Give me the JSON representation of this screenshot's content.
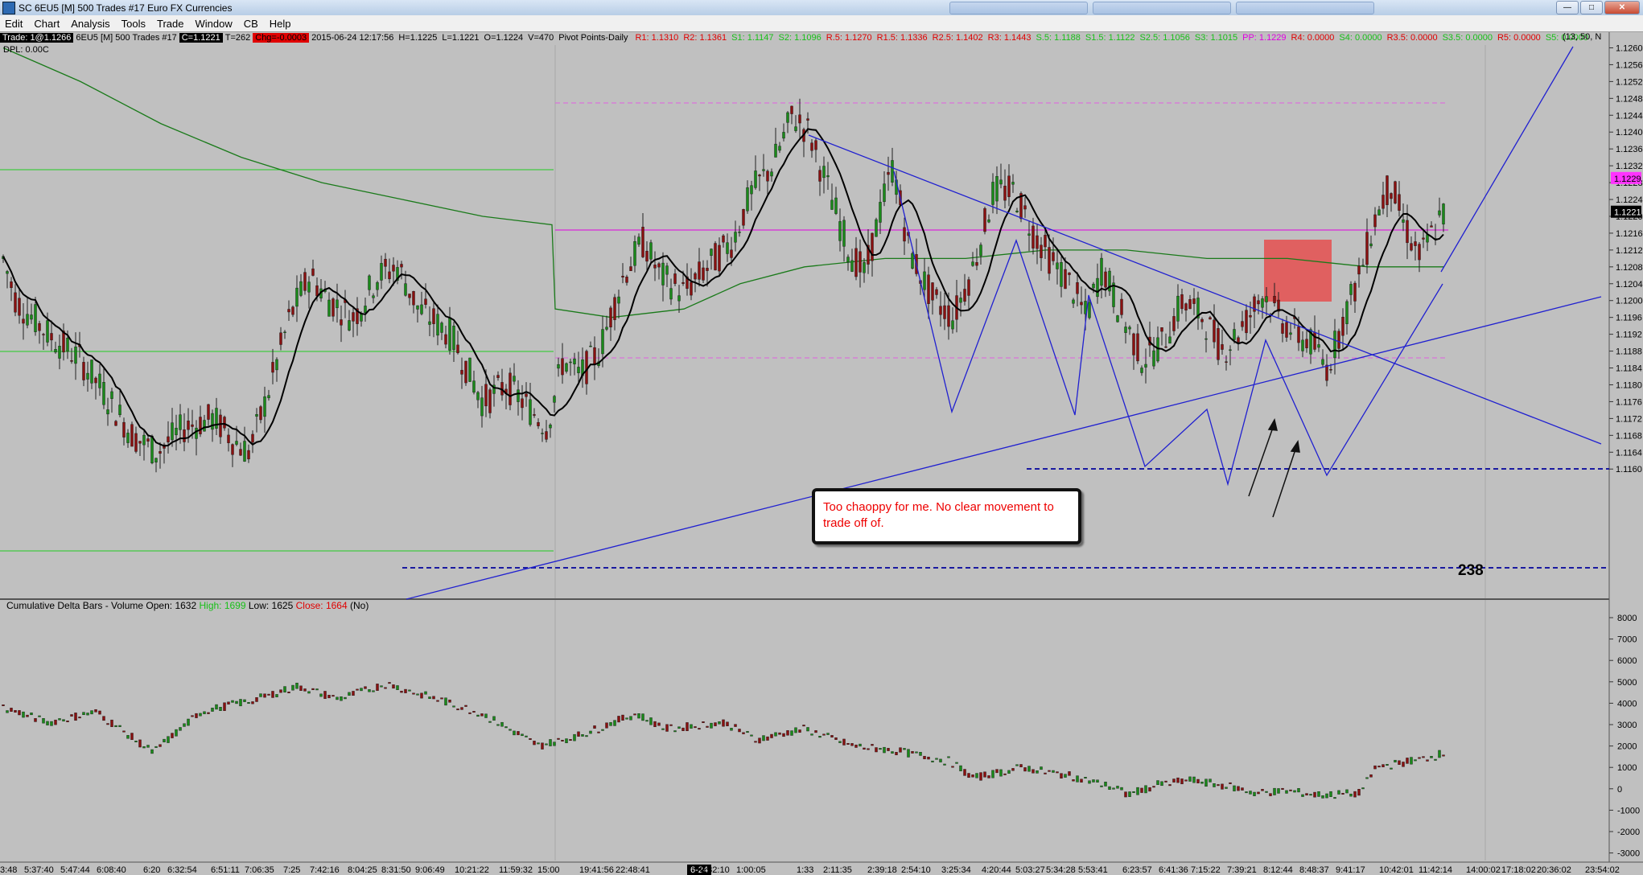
{
  "window": {
    "title": "SC 6EU5 [M]  500 Trades  #17  Euro FX Currencies"
  },
  "menu": [
    "Edit",
    "Chart",
    "Analysis",
    "Tools",
    "Trade",
    "Window",
    "CB",
    "Help"
  ],
  "status": {
    "trade": "Trade: 1@1.1266",
    "symbol": "6EU5 [M]  500 Trades  #17",
    "close": "C=1.1221",
    "ticks": "T=262",
    "change": "Chg=-0.0003",
    "datetime": "2015-06-24 12:17:56",
    "high": "H=1.1225",
    "low": "L=1.1221",
    "open": "O=1.1224",
    "volume": "V=470",
    "study": "Pivot Points-Daily",
    "pivots": [
      {
        "text": "R1: 1.1310",
        "color": "#e00000"
      },
      {
        "text": "R2: 1.1361",
        "color": "#e00000"
      },
      {
        "text": "S1: 1.1147",
        "color": "#18c018"
      },
      {
        "text": "S2: 1.1096",
        "color": "#18c018"
      },
      {
        "text": "R.5: 1.1270",
        "color": "#e00000"
      },
      {
        "text": "R1.5: 1.1336",
        "color": "#e00000"
      },
      {
        "text": "R2.5: 1.1402",
        "color": "#e00000"
      },
      {
        "text": "R3: 1.1443",
        "color": "#e00000"
      },
      {
        "text": "S.5: 1.1188",
        "color": "#18c018"
      },
      {
        "text": "S1.5: 1.1122",
        "color": "#18c018"
      },
      {
        "text": "S2.5: 1.1056",
        "color": "#18c018"
      },
      {
        "text": "S3: 1.1015",
        "color": "#18c018"
      },
      {
        "text": "PP: 1.1229",
        "color": "#e000e0"
      },
      {
        "text": "R4: 0.0000",
        "color": "#e00000"
      },
      {
        "text": "S4: 0.0000",
        "color": "#18c018"
      },
      {
        "text": "R3.5: 0.0000",
        "color": "#e00000"
      },
      {
        "text": "S3.5: 0.0000",
        "color": "#18c018"
      },
      {
        "text": "R5: 0.0000",
        "color": "#e00000"
      },
      {
        "text": "S5: 0.0000",
        "color": "#18c018"
      }
    ],
    "ma_params": "(13, 50, N",
    "dpl": "DPL: 0.00C"
  },
  "price_axis": {
    "labels": [
      "1.1260",
      "1.1256",
      "1.1252",
      "1.1248",
      "1.1244",
      "1.1240",
      "1.1236",
      "1.1232",
      "1.1228",
      "1.1224",
      "1.1220",
      "1.1216",
      "1.1212",
      "1.1208",
      "1.1204",
      "1.1200",
      "1.1196",
      "1.1192",
      "1.1188",
      "1.1184",
      "1.1180",
      "1.1176",
      "1.1172",
      "1.1168",
      "1.1164",
      "1.1160"
    ],
    "badges": [
      {
        "text": "1.1229",
        "value": 1.1229,
        "bg": "#ff33ff",
        "fg": "#000000"
      },
      {
        "text": "1.1221",
        "value": 1.1221,
        "bg": "#000000",
        "fg": "#ffffff"
      }
    ]
  },
  "delta_axis": {
    "labels": [
      "8000",
      "7000",
      "6000",
      "5000",
      "4000",
      "3000",
      "2000",
      "1000",
      "0",
      "-1000",
      "-2000",
      "-3000"
    ]
  },
  "time_axis": {
    "labels": [
      "3:48",
      "5:37:40",
      "5:47:44",
      "6:08:40",
      "6:20",
      "6:32:54",
      "6:51:11",
      "7:06:35",
      "7:25",
      "7:42:16",
      "8:04:25",
      "8:31:50",
      "9:06:49",
      "10:21:22",
      "11:59:32",
      "15:00",
      "19:41:56",
      "22:48:41",
      "6-24",
      "0:32:10",
      "1:00:05",
      "1:33",
      "2:11:35",
      "2:39:18",
      "2:54:10",
      "3:25:34",
      "4:20:44",
      "5:03:27",
      "5:34:28",
      "5:53:41",
      "6:23:57",
      "6:41:36",
      "7:15:22",
      "7:39:21",
      "8:12:44",
      "8:48:37",
      "9:41:17",
      "10:42:01",
      "11:42:14",
      "14:00:02",
      "17:18:02",
      "20:36:02",
      "23:54:02"
    ],
    "date_marker": "6-24"
  },
  "annotations": {
    "note": "Too chaoppy for me.  No clear movement to trade off of.",
    "fib_label": "238"
  },
  "lower_panel": {
    "study": "Cumulative Delta Bars - Volume",
    "open": "Open: 1632",
    "high": "High: 1699",
    "low": "Low: 1625",
    "close": "Close: 1664",
    "flag": "(No)"
  },
  "colors": {
    "background": "#c0c0c0",
    "up_bar": "#1a8a1a",
    "down_bar": "#8a1010",
    "trendline": "#2020d0",
    "pivot": "#e000e0",
    "support_green": "#22cc22",
    "ma_slow": "#1a7a1a",
    "ma_fast": "#000000",
    "zone": "#e06060"
  }
}
